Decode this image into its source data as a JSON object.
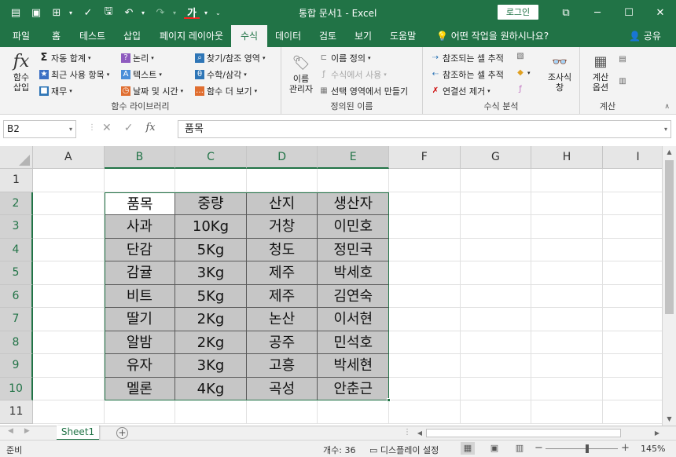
{
  "window": {
    "title": "통합 문서1 - Excel",
    "login_label": "로그인",
    "controls": [
      "⧉",
      "─",
      "☐",
      "✕"
    ]
  },
  "tabs": [
    "파일",
    "홈",
    "테스트",
    "삽입",
    "페이지 레이아웃",
    "수식",
    "데이터",
    "검토",
    "보기",
    "도움말"
  ],
  "active_tab": "수식",
  "tell_me": "어떤 작업을 원하시나요?",
  "share_label": "공유",
  "ribbon": {
    "function_library": {
      "insert_function": "함수 삽입",
      "insert_function_line1": "함수",
      "insert_function_line2": "삽입",
      "autosum": "자동 합계",
      "recent": "최근 사용 항목",
      "financial": "재무",
      "logical": "논리",
      "text": "텍스트",
      "datetime": "날짜 및 시간",
      "lookup": "찾기/참조 영역",
      "math": "수학/삼각",
      "more": "함수 더 보기",
      "label": "함수 라이브러리"
    },
    "defined_names": {
      "name_manager_line1": "이름",
      "name_manager_line2": "관리자",
      "define_name": "이름 정의",
      "use_in_formula": "수식에서 사용",
      "create_from_selection": "선택 영역에서 만들기",
      "label": "정의된 이름"
    },
    "formula_auditing": {
      "trace_precedents": "참조되는 셀 추적",
      "trace_dependents": "참조하는 셀 추적",
      "remove_arrows": "연결선 제거",
      "watch_line1": "조사식",
      "watch_line2": "창",
      "label": "수식 분석"
    },
    "calculation": {
      "options_line1": "계산",
      "options_line2": "옵션",
      "label": "계산"
    }
  },
  "formula_bar": {
    "name_box": "B2",
    "content": "품목"
  },
  "columns": [
    "A",
    "B",
    "C",
    "D",
    "E",
    "F",
    "G",
    "H",
    "I"
  ],
  "rows": [
    "1",
    "2",
    "3",
    "4",
    "5",
    "6",
    "7",
    "8",
    "9",
    "10",
    "11"
  ],
  "table": [
    [
      "품목",
      "중량",
      "산지",
      "생산자"
    ],
    [
      "사과",
      "10Kg",
      "거창",
      "이민호"
    ],
    [
      "단감",
      "5Kg",
      "청도",
      "정민국"
    ],
    [
      "감귤",
      "3Kg",
      "제주",
      "박세호"
    ],
    [
      "비트",
      "5Kg",
      "제주",
      "김연숙"
    ],
    [
      "딸기",
      "2Kg",
      "논산",
      "이서현"
    ],
    [
      "알밤",
      "2Kg",
      "공주",
      "민석호"
    ],
    [
      "유자",
      "3Kg",
      "고흥",
      "박세현"
    ],
    [
      "멜론",
      "4Kg",
      "곡성",
      "안춘근"
    ]
  ],
  "sheet_tab": "Sheet1",
  "status": {
    "ready": "준비",
    "count": "개수: 36",
    "display_settings": "디스플레이 설정",
    "zoom": "145%",
    "zoom_level_pct": 145
  },
  "colors": {
    "accent": "#217346",
    "data_fill": "#c6c6c6"
  }
}
